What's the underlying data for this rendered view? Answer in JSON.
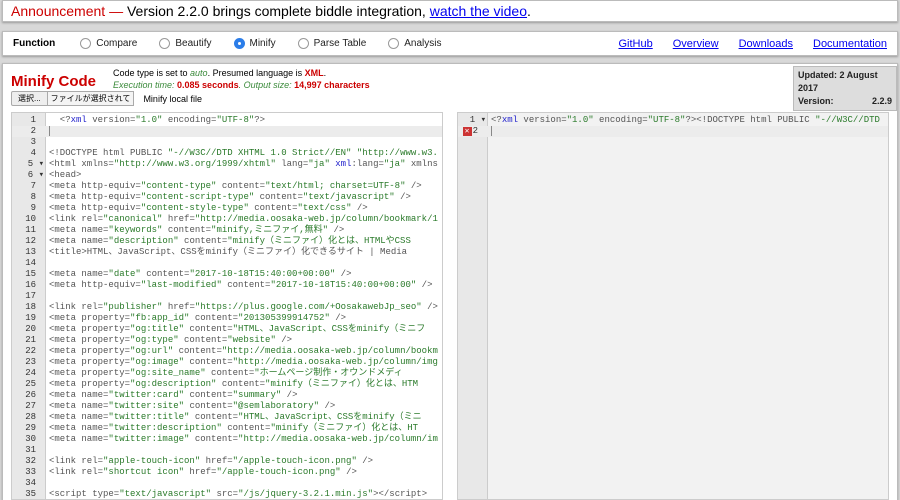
{
  "announcement": {
    "label": "Announcement —",
    "text": " Version 2.2.0 brings complete biddle integration, ",
    "link": "watch the video",
    "end": "."
  },
  "nav": {
    "function_label": "Function",
    "options": [
      "Compare",
      "Beautify",
      "Minify",
      "Parse Table",
      "Analysis"
    ],
    "selected": "Minify",
    "links": [
      "GitHub",
      "Overview",
      "Downloads",
      "Documentation"
    ]
  },
  "main": {
    "title": "Minify Code",
    "info1": {
      "a": "Code type is set to ",
      "b": "auto",
      "c": ". Presumed language is ",
      "d": "XML",
      "e": "."
    },
    "info2": {
      "a": "Execution time: ",
      "b": "0.085 seconds",
      "c": ". Output size: ",
      "d": "14,997 characters"
    },
    "file_button": "選択...",
    "file_name": "ファイルが選択されて",
    "file_label": "Minify local file",
    "updated": "Updated: 2 August 2017",
    "version_label": "Version:",
    "version": "2.2.9"
  },
  "input_lines": [
    "  <?xml version=\"1.0\" encoding=\"UTF-8\"?>",
    "",
    "",
    "<!DOCTYPE html PUBLIC \"-//W3C//DTD XHTML 1.0 Strict//EN\" \"http://www.w3.",
    "<html xmlns=\"http://www.w3.org/1999/xhtml\" lang=\"ja\" xml:lang=\"ja\" xmlns",
    "<head>",
    "<meta http-equiv=\"content-type\" content=\"text/html; charset=UTF-8\" />",
    "<meta http-equiv=\"content-script-type\" content=\"text/javascript\" />",
    "<meta http-equiv=\"content-style-type\" content=\"text/css\" />",
    "<link rel=\"canonical\" href=\"http://media.oosaka-web.jp/column/bookmark/1",
    "<meta name=\"keywords\" content=\"minify,ミニファイ,無料\" />",
    "<meta name=\"description\" content=\"minify（ミニファイ）化とは、HTMLやCSS",
    "<title>HTML、JavaScript、CSSをminify（ミニファイ）化できるサイト | Media",
    "",
    "<meta name=\"date\" content=\"2017-10-18T15:40:00+00:00\" />",
    "<meta http-equiv=\"last-modified\" content=\"2017-10-18T15:40:00+00:00\" />",
    "",
    "<link rel=\"publisher\" href=\"https://plus.google.com/+OosakawebJp_seo\" />",
    "<meta property=\"fb:app_id\" content=\"201305399914752\" />",
    "<meta property=\"og:title\" content=\"HTML、JavaScript、CSSをminify（ミニフ",
    "<meta property=\"og:type\" content=\"website\" />",
    "<meta property=\"og:url\" content=\"http://media.oosaka-web.jp/column/bookm",
    "<meta property=\"og:image\" content=\"http://media.oosaka-web.jp/column/img",
    "<meta property=\"og:site_name\" content=\"ホームページ制作・オウンドメディ",
    "<meta property=\"og:description\" content=\"minify（ミニファイ）化とは、HTM",
    "<meta name=\"twitter:card\" content=\"summary\" />",
    "<meta name=\"twitter:site\" content=\"@semlaboratory\" />",
    "<meta name=\"twitter:title\" content=\"HTML、JavaScript、CSSをminify（ミニ",
    "<meta name=\"twitter:description\" content=\"minify（ミニファイ）化とは、HT",
    "<meta name=\"twitter:image\" content=\"http://media.oosaka-web.jp/column/im",
    "",
    "<link rel=\"apple-touch-icon\" href=\"/apple-touch-icon.png\" />",
    "<link rel=\"shortcut icon\" href=\"/apple-touch-icon.png\" />",
    "",
    "<script type=\"text/javascript\" src=\"/js/jquery-3.2.1.min.js\"></script>"
  ],
  "fold_lines": [
    5,
    6
  ],
  "output_lines": [
    "<?xml version=\"1.0\" encoding=\"UTF-8\"?><!DOCTYPE html PUBLIC \"-//W3C//DTD",
    ""
  ],
  "output_error_line": 2
}
